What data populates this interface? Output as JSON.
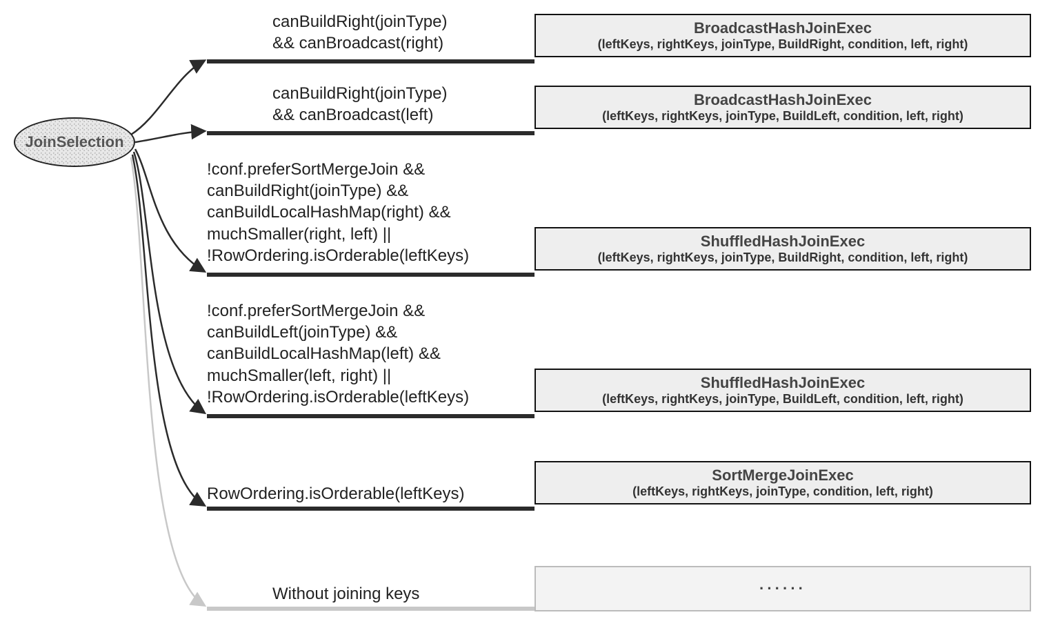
{
  "source": {
    "label": "JoinSelection"
  },
  "branches": [
    {
      "condition": "canBuildRight(joinType)\n&& canBroadcast(right)",
      "box": {
        "title": "BroadcastHashJoinExec",
        "args": "(leftKeys, rightKeys, joinType, BuildRight, condition, left, right)"
      }
    },
    {
      "condition": "canBuildRight(joinType)\n&& canBroadcast(left)",
      "box": {
        "title": "BroadcastHashJoinExec",
        "args": "(leftKeys, rightKeys, joinType, BuildLeft, condition, left, right)"
      }
    },
    {
      "condition": "!conf.preferSortMergeJoin &&\ncanBuildRight(joinType) &&\ncanBuildLocalHashMap(right) &&\nmuchSmaller(right, left) ||\n!RowOrdering.isOrderable(leftKeys)",
      "box": {
        "title": "ShuffledHashJoinExec",
        "args": "(leftKeys, rightKeys, joinType, BuildRight, condition, left, right)"
      }
    },
    {
      "condition": "!conf.preferSortMergeJoin &&\ncanBuildLeft(joinType) &&\ncanBuildLocalHashMap(left) &&\nmuchSmaller(left, right) ||\n!RowOrdering.isOrderable(leftKeys)",
      "box": {
        "title": "ShuffledHashJoinExec",
        "args": "(leftKeys, rightKeys, joinType, BuildLeft, condition, left, right)"
      }
    },
    {
      "condition": "RowOrdering.isOrderable(leftKeys)",
      "box": {
        "title": "SortMergeJoinExec",
        "args": "(leftKeys, rightKeys, joinType, condition, left, right)"
      }
    },
    {
      "condition": "Without joining keys",
      "box": {
        "title": "······",
        "args": ""
      }
    }
  ]
}
